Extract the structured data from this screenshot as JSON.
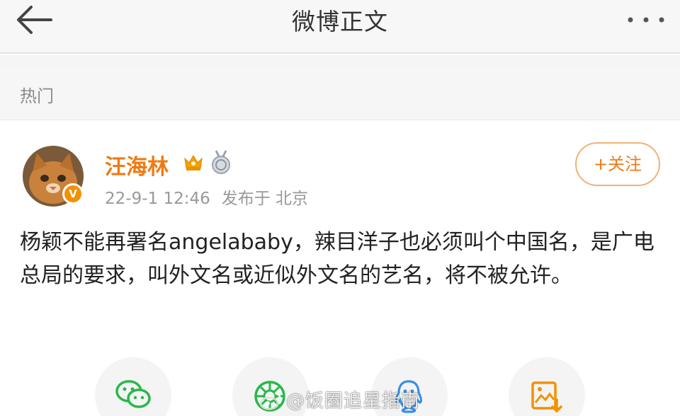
{
  "header": {
    "title": "微博正文"
  },
  "section": {
    "label": "热门"
  },
  "post": {
    "author": {
      "name": "汪海林",
      "verified_badge": "V"
    },
    "timestamp": "22-9-1 12:46",
    "location": "发布于 北京",
    "follow_label": "+关注",
    "text": "杨颖不能再署名angelababy，辣目洋子也必须叫个中国名，是广电总局的要求，叫外文名或近似外文名的艺名，将不被允许。"
  },
  "share": {
    "buttons": [
      {
        "icon": "wechat-icon"
      },
      {
        "icon": "moments-icon"
      },
      {
        "icon": "qq-icon"
      },
      {
        "icon": "save-image-icon"
      }
    ]
  },
  "watermark": {
    "text": "@饭圈追星指南"
  },
  "colors": {
    "accent": "#ef7a12",
    "share_green": "#28b84a",
    "share_blue": "#3a8ee6",
    "share_orange": "#f29100"
  }
}
